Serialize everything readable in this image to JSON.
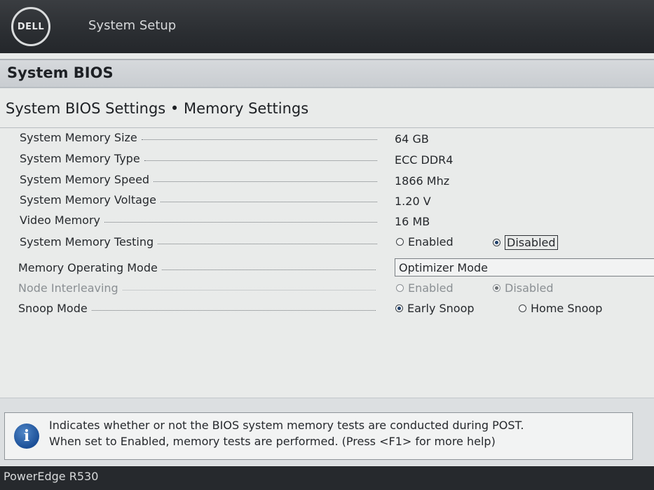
{
  "app": {
    "logo_text": "DELL",
    "title": "System Setup"
  },
  "header": {
    "title": "System BIOS"
  },
  "page": {
    "title": "System BIOS Settings • Memory Settings"
  },
  "settings": {
    "memory_size": {
      "label": "System Memory Size",
      "value": "64 GB"
    },
    "memory_type": {
      "label": "System Memory Type",
      "value": "ECC DDR4"
    },
    "memory_speed": {
      "label": "System Memory Speed",
      "value": "1866 Mhz"
    },
    "memory_voltage": {
      "label": "System Memory Voltage",
      "value": "1.20 V"
    },
    "video_memory": {
      "label": "Video Memory",
      "value": "16 MB"
    },
    "memory_testing": {
      "label": "System Memory Testing",
      "options": [
        "Enabled",
        "Disabled"
      ],
      "selected": "Disabled"
    },
    "operating_mode": {
      "label": "Memory Operating Mode",
      "value": "Optimizer Mode"
    },
    "node_interleaving": {
      "label": "Node Interleaving",
      "options": [
        "Enabled",
        "Disabled"
      ],
      "selected": "Disabled",
      "disabled": true
    },
    "snoop_mode": {
      "label": "Snoop Mode",
      "options": [
        "Early Snoop",
        "Home Snoop"
      ],
      "selected": "Early Snoop"
    }
  },
  "help": {
    "icon": "info-icon",
    "icon_glyph": "i",
    "line1": "Indicates whether or not the BIOS system memory tests are conducted during POST.",
    "line2": "When set to Enabled, memory tests are performed. (Press <F1> for more help)"
  },
  "footer": {
    "model": "PowerEdge R530"
  },
  "colors": {
    "topbar": "#2b2e32",
    "header": "#c9cdd1",
    "background": "#e9ebea",
    "info_blue": "#1b4f97"
  }
}
